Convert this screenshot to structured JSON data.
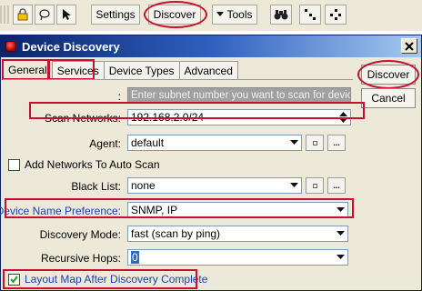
{
  "toolbar": {
    "settings_label": "Settings",
    "discover_label": "Discover",
    "tools_label": "Tools"
  },
  "dialog": {
    "title": "Device Discovery",
    "tabs": [
      "General",
      "Services",
      "Device Types",
      "Advanced"
    ],
    "discover_button": "Discover",
    "cancel_button": "Cancel"
  },
  "form": {
    "hint": {
      "label": ":",
      "value": "Enter subnet number you want to scan for devices"
    },
    "scan_networks": {
      "label": "Scan Networks:",
      "value": "192.168.2.0/24"
    },
    "agent": {
      "label": "Agent:",
      "value": "default"
    },
    "add_networks": {
      "label": "Add Networks To Auto Scan",
      "checked": false
    },
    "black_list": {
      "label": "Black List:",
      "value": "none"
    },
    "device_name_pref": {
      "label": "Device Name Preference:",
      "value": "SNMP, IP"
    },
    "discovery_mode": {
      "label": "Discovery Mode:",
      "value": "fast (scan by ping)"
    },
    "recursive_hops": {
      "label": "Recursive Hops:",
      "value": "0"
    },
    "layout_map": {
      "label": "Layout Map After Discovery Complete",
      "checked": true
    },
    "small_btn_ellipsis": "..."
  },
  "colors": {
    "annotation": "#c8102e",
    "title_bar": "#0a246a",
    "label_highlight": "#1c3fbf"
  }
}
